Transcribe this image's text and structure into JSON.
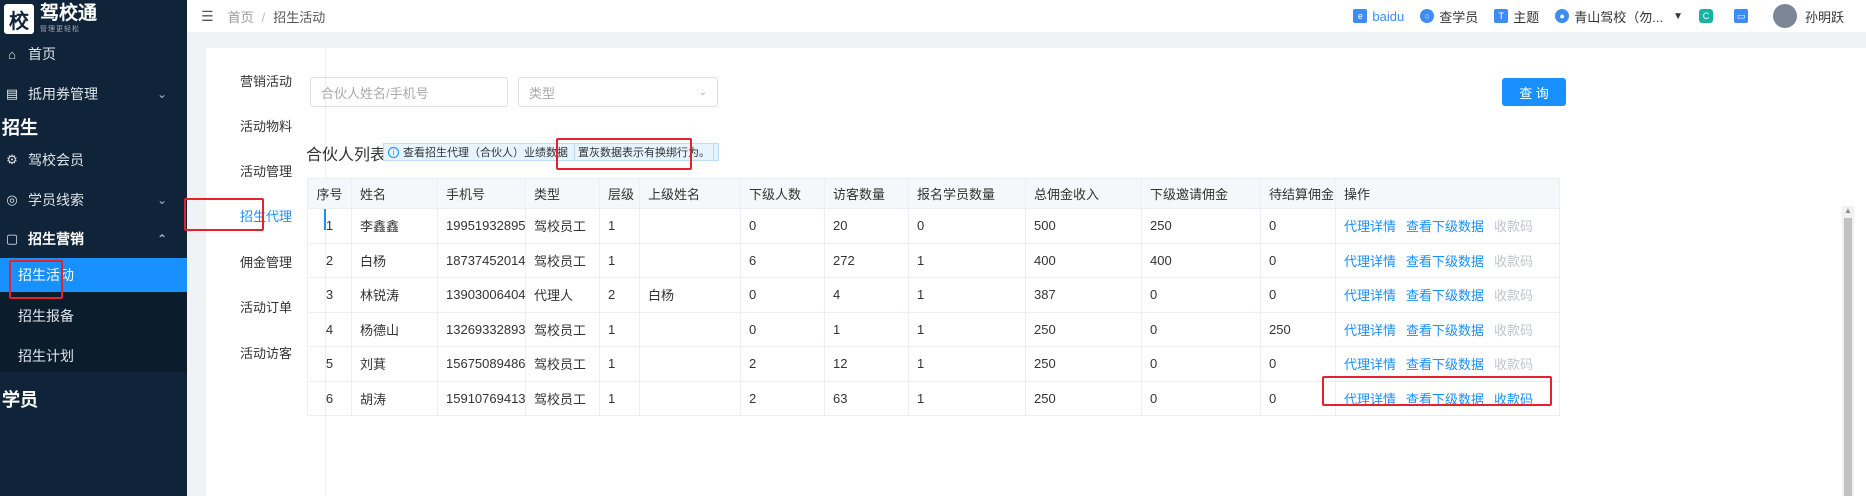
{
  "sidebar": {
    "logo": {
      "badge": "校",
      "title": "驾校通",
      "sub": "管理更轻松"
    },
    "items": {
      "home": "首页",
      "voucher": "抵用券管理",
      "section_enroll": "招生",
      "member": "驾校会员",
      "leads": "学员线索",
      "marketing": "招生营销",
      "activity": "招生活动",
      "report": "招生报备",
      "plan": "招生计划",
      "section_student": "学员"
    }
  },
  "header": {
    "breadcrumb": {
      "home": "首页",
      "current": "招生活动"
    },
    "baidu": "baidu",
    "find_student": "查学员",
    "theme": "主题",
    "school": "青山驾校（勿...",
    "user": "孙明跃"
  },
  "subnav": [
    "营销活动",
    "活动物料",
    "活动管理",
    "招生代理",
    "佣金管理",
    "活动订单",
    "活动访客"
  ],
  "search": {
    "partner_placeholder": "合伙人姓名/手机号",
    "type_placeholder": "类型",
    "query_label": "查 询"
  },
  "list": {
    "title": "合伙人列表",
    "info": "查看招生代理（合伙人）业绩数据",
    "info_note": "置灰数据表示有换绑行为。"
  },
  "table": {
    "headers": [
      "序号",
      "姓名",
      "手机号",
      "类型",
      "层级",
      "上级姓名",
      "下级人数",
      "访客数量",
      "报名学员数量",
      "总佣金收入",
      "下级邀请佣金",
      "待结算佣金",
      "操作"
    ],
    "actions": {
      "detail": "代理详情",
      "sub": "查看下级数据",
      "qr": "收款码"
    },
    "rows": [
      {
        "no": "1",
        "name": "李鑫鑫",
        "phone": "19951932895",
        "type": "驾校员工",
        "level": "1",
        "parent": "",
        "subs": "0",
        "visitors": "20",
        "signups": "0",
        "total": "500",
        "invite": "250",
        "pending": "0",
        "qr_enabled": false
      },
      {
        "no": "2",
        "name": "白杨",
        "phone": "18737452014",
        "type": "驾校员工",
        "level": "1",
        "parent": "",
        "subs": "6",
        "visitors": "272",
        "signups": "1",
        "total": "400",
        "invite": "400",
        "pending": "0",
        "qr_enabled": false
      },
      {
        "no": "3",
        "name": "林锐涛",
        "phone": "13903006404",
        "type": "代理人",
        "level": "2",
        "parent": "白杨",
        "subs": "0",
        "visitors": "4",
        "signups": "1",
        "total": "387",
        "invite": "0",
        "pending": "0",
        "qr_enabled": false
      },
      {
        "no": "4",
        "name": "杨德山",
        "phone": "13269332893",
        "type": "驾校员工",
        "level": "1",
        "parent": "",
        "subs": "0",
        "visitors": "1",
        "signups": "1",
        "total": "250",
        "invite": "0",
        "pending": "250",
        "qr_enabled": false
      },
      {
        "no": "5",
        "name": "刘萁",
        "phone": "15675089486",
        "type": "驾校员工",
        "level": "1",
        "parent": "",
        "subs": "2",
        "visitors": "12",
        "signups": "1",
        "total": "250",
        "invite": "0",
        "pending": "0",
        "qr_enabled": false
      },
      {
        "no": "6",
        "name": "胡涛",
        "phone": "15910769413",
        "type": "驾校员工",
        "level": "1",
        "parent": "",
        "subs": "2",
        "visitors": "63",
        "signups": "1",
        "total": "250",
        "invite": "0",
        "pending": "0",
        "qr_enabled": true
      }
    ]
  },
  "colors": {
    "primary": "#1890ff",
    "sidebar": "#0f2438",
    "highlight": "#e5212b",
    "disabled": "#c0c4cc"
  }
}
